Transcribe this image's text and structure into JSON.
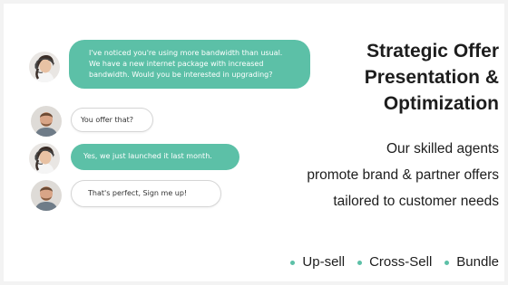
{
  "conversation": [
    {
      "role": "agent",
      "lines": [
        "I've noticed you're using more bandwidth than usual.",
        "We have a new internet package with increased",
        "bandwidth. Would you be interested in upgrading?"
      ]
    },
    {
      "role": "customer",
      "lines": [
        "You offer that?"
      ]
    },
    {
      "role": "agent",
      "lines": [
        "Yes, we just launched it last month."
      ]
    },
    {
      "role": "customer",
      "lines": [
        "That's perfect, Sign me up!"
      ]
    }
  ],
  "headline": {
    "lines": [
      "Strategic Offer",
      "Presentation &",
      "Optimization"
    ]
  },
  "description": {
    "lines": [
      "Our skilled agents",
      "promote brand & partner offers",
      "tailored to customer needs"
    ]
  },
  "services": [
    "Up-sell",
    "Cross-Sell",
    "Bundle"
  ],
  "colors": {
    "accent": "#5cc0a7",
    "text": "#1d1d1d",
    "background": "#ffffff"
  },
  "icons": {
    "agent_avatar": "agent-headset-avatar-icon",
    "customer_avatar": "customer-avatar-icon"
  }
}
